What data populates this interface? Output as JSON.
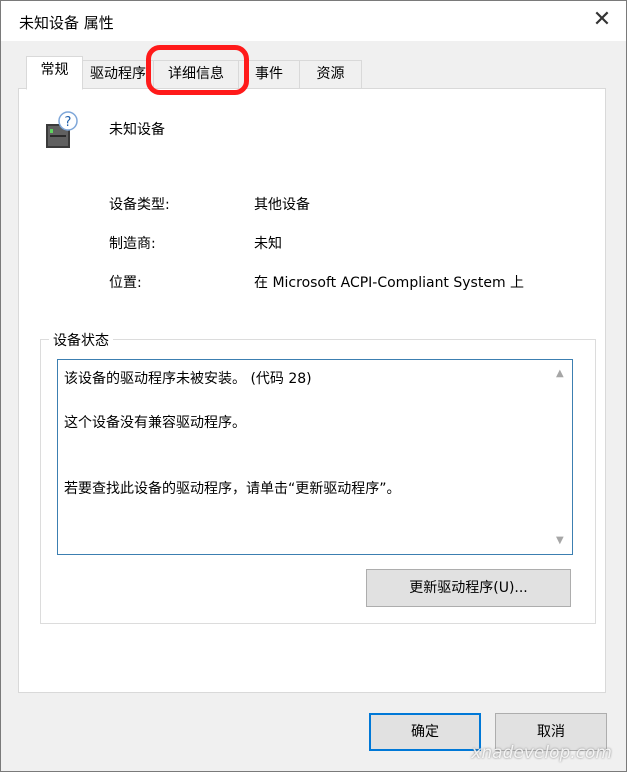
{
  "window": {
    "title": "未知设备 属性",
    "close_icon": "✕"
  },
  "tabs": [
    {
      "label": "常规",
      "active": true
    },
    {
      "label": "驱动程序"
    },
    {
      "label": "详细信息"
    },
    {
      "label": "事件"
    },
    {
      "label": "资源"
    }
  ],
  "device": {
    "name": "未知设备",
    "properties": [
      {
        "label": "设备类型:",
        "value": "其他设备"
      },
      {
        "label": "制造商:",
        "value": "未知"
      },
      {
        "label": "位置:",
        "value": "在 Microsoft ACPI-Compliant System 上"
      }
    ]
  },
  "status": {
    "group_title": "设备状态",
    "lines": [
      "该设备的驱动程序未被安装。 (代码 28)",
      "这个设备没有兼容驱动程序。",
      "若要查找此设备的驱动程序，请单击“更新驱动程序”。"
    ]
  },
  "buttons": {
    "update_driver": "更新驱动程序(U)...",
    "ok": "确定",
    "cancel": "取消"
  },
  "watermark": "xnadevelop.com",
  "colors": {
    "highlight": "#ff1a1a",
    "accent": "#0078d7"
  }
}
